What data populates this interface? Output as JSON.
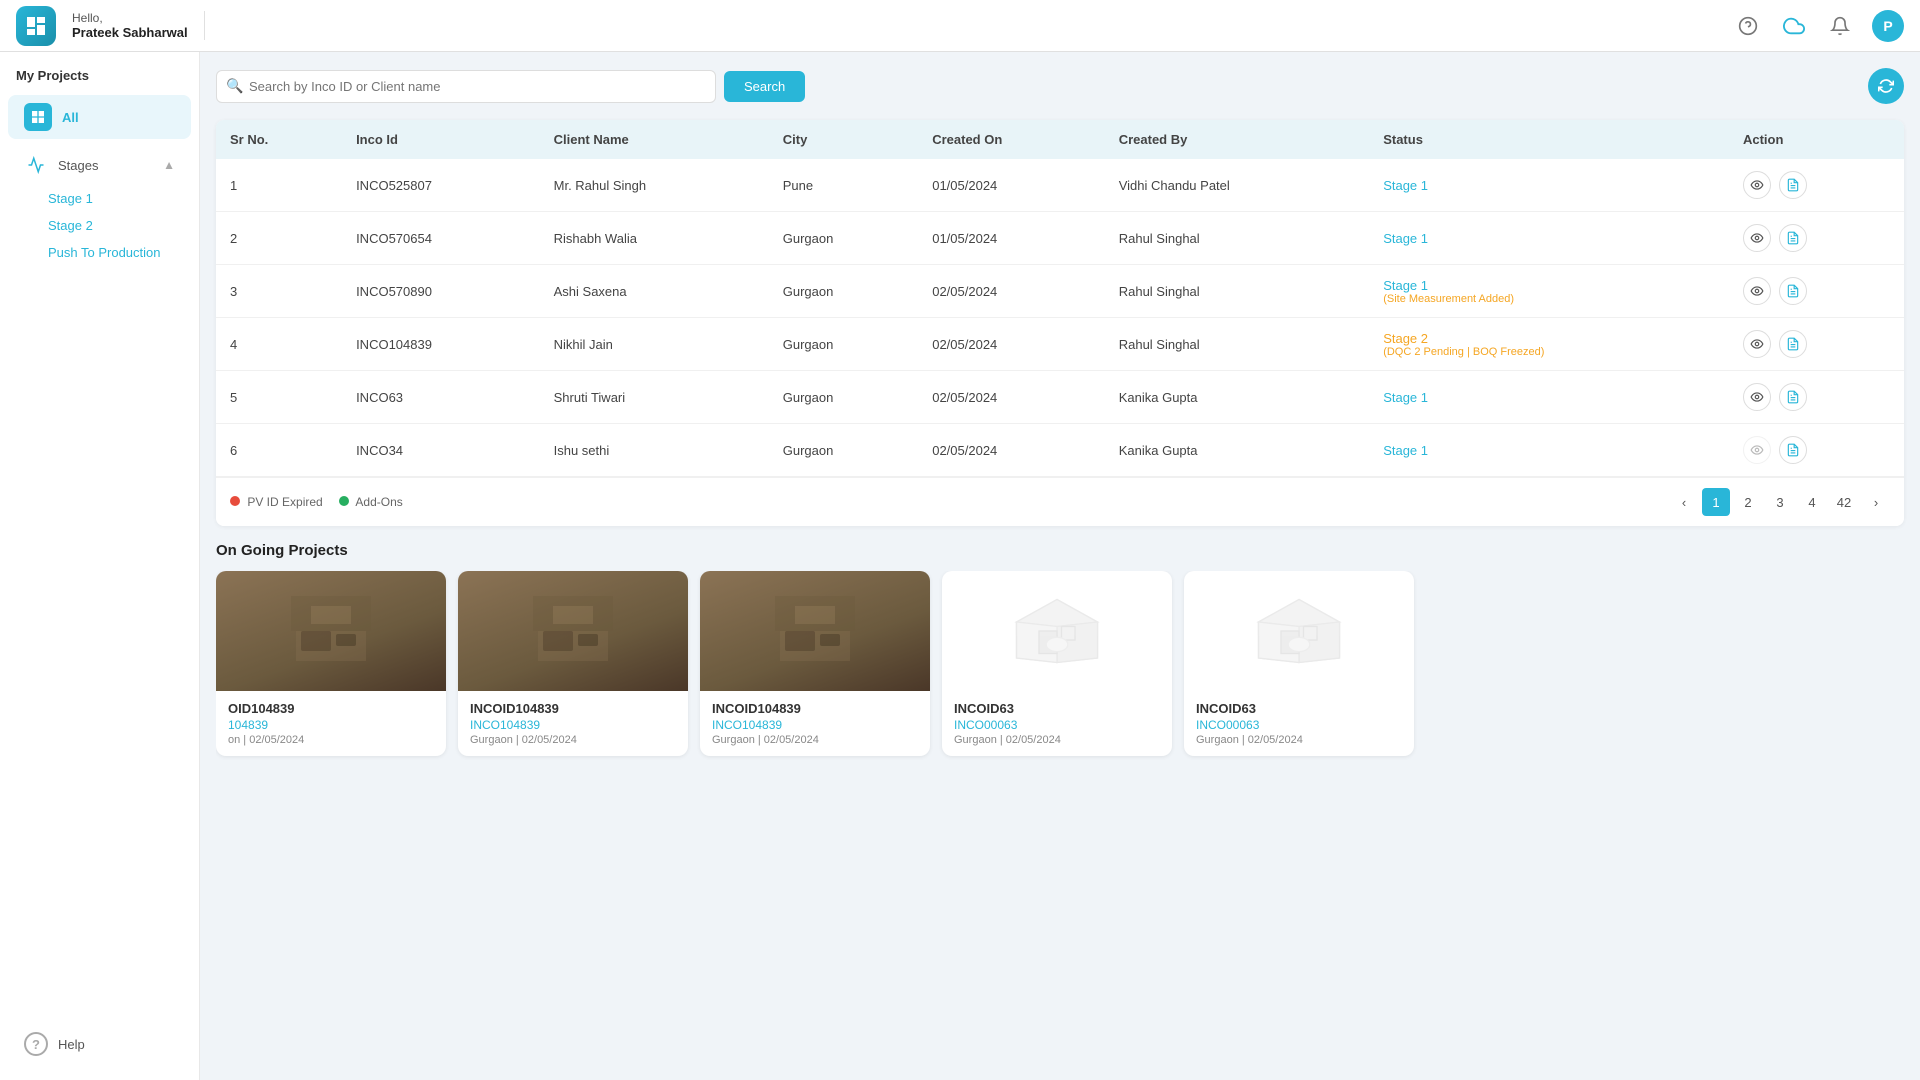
{
  "header": {
    "greeting": "Hello,",
    "user_name": "Prateek Sabharwal"
  },
  "sidebar": {
    "section_title": "My Projects",
    "all_label": "All",
    "stages_label": "Stages",
    "stage1_label": "Stage 1",
    "stage2_label": "Stage 2",
    "push_to_production_label": "Push To Production",
    "help_label": "Help"
  },
  "search": {
    "placeholder": "Search by Inco ID or Client name",
    "button_label": "Search"
  },
  "table": {
    "columns": [
      "Sr No.",
      "Inco Id",
      "Client Name",
      "City",
      "Created On",
      "Created By",
      "Status",
      "Action"
    ],
    "rows": [
      {
        "sr": 1,
        "inco_id": "INCO525807",
        "client": "Mr. Rahul Singh",
        "city": "Pune",
        "created_on": "01/05/2024",
        "created_by": "Vidhi Chandu Patel",
        "status": "Stage 1",
        "status_sub": "",
        "status_type": "stage1"
      },
      {
        "sr": 2,
        "inco_id": "INCO570654",
        "client": "Rishabh Walia",
        "city": "Gurgaon",
        "created_on": "01/05/2024",
        "created_by": "Rahul Singhal",
        "status": "Stage 1",
        "status_sub": "",
        "status_type": "stage1"
      },
      {
        "sr": 3,
        "inco_id": "INCO570890",
        "client": "Ashi Saxena",
        "city": "Gurgaon",
        "created_on": "02/05/2024",
        "created_by": "Rahul Singhal",
        "status": "Stage 1",
        "status_sub": "(Site Measurement Added)",
        "status_type": "stage1"
      },
      {
        "sr": 4,
        "inco_id": "INCO104839",
        "client": "Nikhil Jain",
        "city": "Gurgaon",
        "created_on": "02/05/2024",
        "created_by": "Rahul Singhal",
        "status": "Stage 2",
        "status_sub": "(DQC 2 Pending | BOQ Freezed)",
        "status_type": "stage2"
      },
      {
        "sr": 5,
        "inco_id": "INCO63",
        "client": "Shruti Tiwari",
        "city": "Gurgaon",
        "created_on": "02/05/2024",
        "created_by": "Kanika Gupta",
        "status": "Stage 1",
        "status_sub": "",
        "status_type": "stage1"
      },
      {
        "sr": 6,
        "inco_id": "INCO34",
        "client": "Ishu sethi",
        "city": "Gurgaon",
        "created_on": "02/05/2024",
        "created_by": "Kanika Gupta",
        "status": "Stage 1",
        "status_sub": "",
        "status_type": "stage1"
      }
    ]
  },
  "legend": {
    "expired_label": "PV ID Expired",
    "addons_label": "Add-Ons"
  },
  "pagination": {
    "pages": [
      "1",
      "2",
      "3",
      "4",
      "42"
    ],
    "current": "1"
  },
  "ongoing": {
    "title": "On Going Projects",
    "cards": [
      {
        "id": "OID104839",
        "inco_id": "104839",
        "location": "on | 02/05/2024",
        "type": "dark"
      },
      {
        "id": "INCOID104839",
        "inco_id": "INCO104839",
        "location": "Gurgaon | 02/05/2024",
        "type": "dark"
      },
      {
        "id": "INCOID104839",
        "inco_id": "INCO104839",
        "location": "Gurgaon | 02/05/2024",
        "type": "dark"
      },
      {
        "id": "INCOID63",
        "inco_id": "INCO00063",
        "location": "Gurgaon | 02/05/2024",
        "type": "placeholder"
      },
      {
        "id": "INCOID63",
        "inco_id": "INCO00063",
        "location": "Gurgaon | 02/05/2024",
        "type": "placeholder"
      }
    ]
  }
}
